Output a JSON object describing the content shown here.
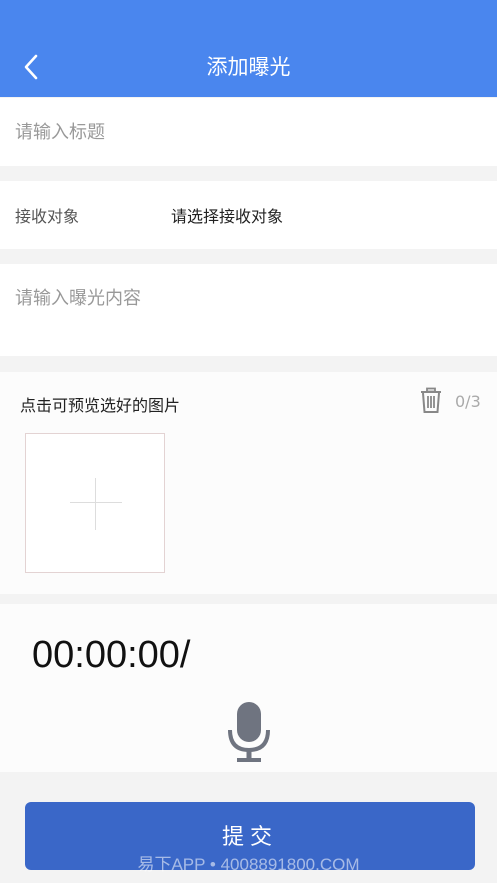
{
  "header": {
    "title": "添加曝光"
  },
  "form": {
    "title_placeholder": "请输入标题",
    "recipient_label": "接收对象",
    "recipient_value": "请选择接收对象",
    "content_placeholder": "请输入曝光内容"
  },
  "photos": {
    "label": "点击可预览选好的图片",
    "count": "0/3"
  },
  "audio": {
    "timer": "00:00:00/"
  },
  "submit": {
    "label": "提交"
  },
  "watermark": "易下APP • 4008891800.COM",
  "icons": {
    "back": "chevron-left-icon",
    "trash": "trash-icon",
    "add": "plus-icon",
    "mic": "microphone-icon"
  },
  "colors": {
    "header": "#4a86ee",
    "submit": "#3a67c8",
    "background": "#f3f3f3"
  }
}
